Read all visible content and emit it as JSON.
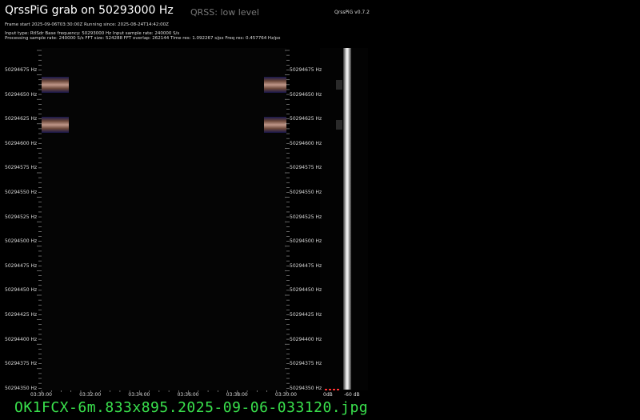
{
  "header": {
    "title": "QrssPiG grab on 50293000 Hz",
    "mode": "QRSS: low level",
    "version": "QrssPiG v0.7.2",
    "meta_line1": "Frame start 2025-09-06T03:30:00Z Running since: 2025-08-24T14:42:00Z",
    "meta_line2": "Input type: RtlSdr Base frequency: 50293000 Hz Input sample rate: 240000 S/s",
    "meta_line3": "Processing sample rate: 240000 S/s FFT size: 524288 FFT overlap: 262144 Time res: 1.092267 s/px Freq res: 0.457764 Hz/px"
  },
  "freq_labels": [
    "50294675 Hz",
    "50294650 Hz",
    "50294625 Hz",
    "50294600 Hz",
    "50294575 Hz",
    "50294550 Hz",
    "50294525 Hz",
    "50294500 Hz",
    "50294475 Hz",
    "50294450 Hz",
    "50294425 Hz",
    "50294400 Hz",
    "50294375 Hz",
    "50294350 Hz"
  ],
  "time_labels": [
    "03:30:00",
    "03:32:00",
    "03:34:00",
    "03:36:00",
    "03:38:00",
    "03:30:00"
  ],
  "db_scale": {
    "max_label": "0dB",
    "min_label": "-60 dB"
  },
  "footer": {
    "filename": "OK1FCX-6m.833x895.2025-09-06-033120.jpg"
  },
  "colors": {
    "background": "#000000",
    "filename": "#39e04c",
    "text": "#dddddd"
  }
}
